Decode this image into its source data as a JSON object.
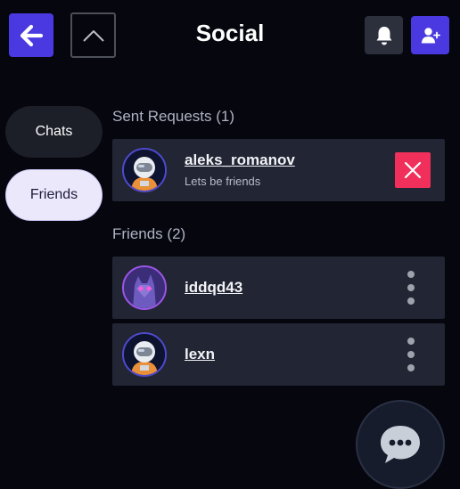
{
  "header": {
    "title": "Social",
    "icons": {
      "back": "arrow-left-icon",
      "collapse": "chevron-up-icon",
      "notifications": "bell-icon",
      "add_friend": "user-plus-icon"
    }
  },
  "tabs": [
    {
      "label": "Chats",
      "active": false
    },
    {
      "label": "Friends",
      "active": true
    }
  ],
  "sent_requests": {
    "heading": "Sent Requests (1)",
    "items": [
      {
        "username": "aleks_romanov",
        "message": "Lets be friends",
        "avatar": "astronaut-avatar",
        "action_icon": "close-icon"
      }
    ]
  },
  "friends": {
    "heading": "Friends (2)",
    "items": [
      {
        "username": "iddqd43",
        "avatar": "wolf-avatar",
        "action_icon": "more-vertical-icon"
      },
      {
        "username": "lexn",
        "avatar": "astronaut-avatar",
        "action_icon": "more-vertical-icon"
      }
    ]
  },
  "chat_fab": {
    "icon": "chat-bubble-icon"
  },
  "colors": {
    "background": "#05060e",
    "accent": "#4a39e0",
    "card": "#222533",
    "danger": "#f0305a"
  }
}
